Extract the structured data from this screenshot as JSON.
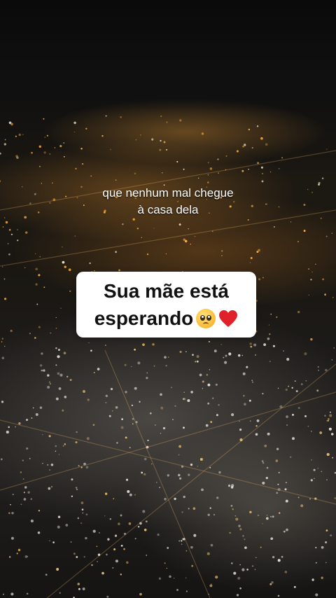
{
  "overlay": {
    "caption_lines": [
      "que nenhum mal chegue",
      "à casa dela"
    ],
    "sticker": {
      "line1": "Sua mãe está",
      "line2": "esperando",
      "emojis": [
        "pleading-face-icon",
        "red-heart-icon"
      ]
    }
  },
  "colors": {
    "sticker_bg": "#ffffff",
    "sticker_text": "#111111",
    "caption_text": "#ffffff",
    "city_light": "#ffb347",
    "heart": "#e0212b"
  }
}
